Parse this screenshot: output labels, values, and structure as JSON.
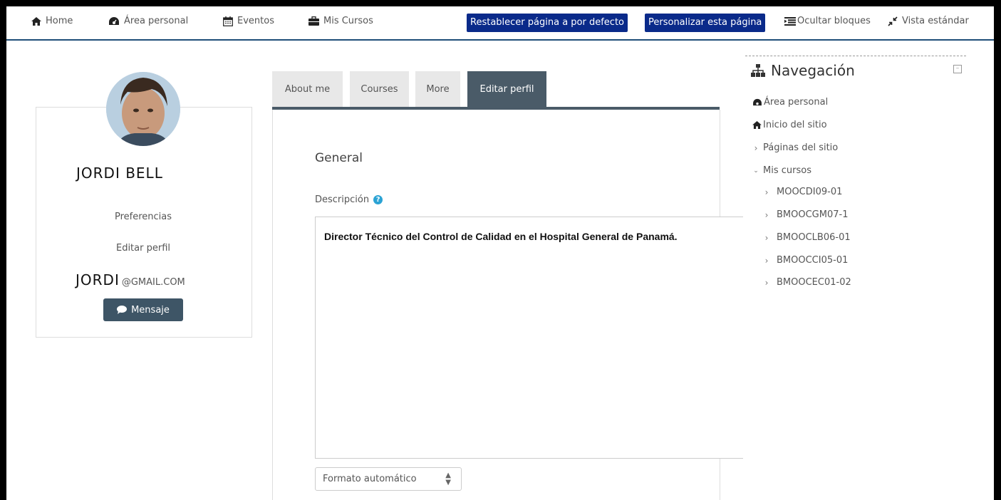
{
  "navbar": {
    "home": "Home",
    "area_personal": "Área personal",
    "eventos": "Eventos",
    "mis_cursos": "Mis Cursos",
    "reset_btn": "Restablecer página a por defecto",
    "customize_btn": "Personalizar esta página",
    "hide_blocks": "Ocultar bloques",
    "standard_view": "Vista estándar",
    "button_color": "#0a2a8a"
  },
  "profile": {
    "name": "JORDI BELL",
    "preferences": "Preferencias",
    "edit_profile": "Editar perfil",
    "email_user": "JORDI",
    "email_domain": "@GMAIL.COM",
    "message_btn": "Mensaje"
  },
  "tabs": [
    {
      "label": "About me"
    },
    {
      "label": "Courses"
    },
    {
      "label": "More"
    },
    {
      "label": "Editar perfil",
      "active": true
    }
  ],
  "form": {
    "section_title": "General",
    "description_label": "Descripción",
    "description_text": "Director Técnico del Control de Calidad en el Hospital General de Panamá.",
    "format_value": "Formato automático"
  },
  "navigation": {
    "title": "Navegación",
    "items": [
      {
        "label": "Área personal",
        "icon": "dashboard-icon"
      },
      {
        "label": "Inicio del sitio",
        "icon": "home-icon"
      },
      {
        "label": "Páginas del sitio",
        "icon": "chevron-right-icon"
      },
      {
        "label": "Mis cursos",
        "icon": "chevron-down-icon"
      }
    ],
    "courses": [
      "MOOCDI09-01",
      "BMOOCGM07-1",
      "BMOOCLB06-01",
      "BMOOCCI05-01",
      "BMOOCEC01-02"
    ]
  }
}
